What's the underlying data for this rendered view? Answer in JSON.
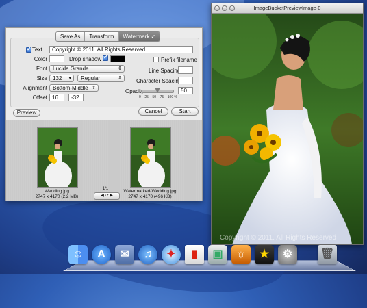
{
  "dialog": {
    "tabs": [
      {
        "label": "Save As"
      },
      {
        "label": "Transform"
      },
      {
        "label": "Watermark ✓"
      }
    ],
    "text_checkbox_label": "Text",
    "text_value": "Copyright © 2011. All Rights Reserved",
    "color_label": "Color",
    "drop_shadow_label": "Drop shadow",
    "prefix_filename_label": "Prefix filename",
    "font_label": "Font",
    "font_value": "Lucida Grande",
    "size_label": "Size",
    "size_value": "132",
    "style_value": "Regular",
    "alignment_label": "Alignment",
    "alignment_value": "Bottom-Middle",
    "offset_label": "Offset",
    "offset_x": "16",
    "offset_y": "-32",
    "line_spacing_label": "Line Spacing",
    "character_spacing_label": "Character Spacing",
    "opacity_label": "Opacity",
    "opacity_value": "50",
    "opacity_level": 0.5,
    "opacity_ticks": [
      "0",
      "25",
      "50",
      "75",
      "100 %"
    ],
    "preview_button": "Preview",
    "cancel_button": "Cancel",
    "start_button": "Start",
    "colors": {
      "text_color": "#ffffff",
      "shadow_color": "#000000",
      "active_tab": "#7a7a7a"
    }
  },
  "browser": {
    "left_file": {
      "name": "Wedding.jpg",
      "meta": "2747 x 4170 (2.2 MB)"
    },
    "right_file": {
      "name": "Watermarked-Wedding.jpg",
      "meta": "2747 x 4170 (496 KB)"
    },
    "pager": "1/1"
  },
  "preview_window": {
    "title": "ImageBucketPreviewImage-0",
    "watermark_text": "Copyright © 2011. All Rights Reserved"
  },
  "dock": {
    "icons": [
      "finder-icon",
      "app-store-icon",
      "mail-stamp-icon",
      "itunes-icon",
      "safari-icon",
      "paint-can-icon",
      "photo-stack-icon",
      "iphoto-icon",
      "imovie-icon",
      "system-preferences-icon",
      "trash-icon"
    ]
  }
}
